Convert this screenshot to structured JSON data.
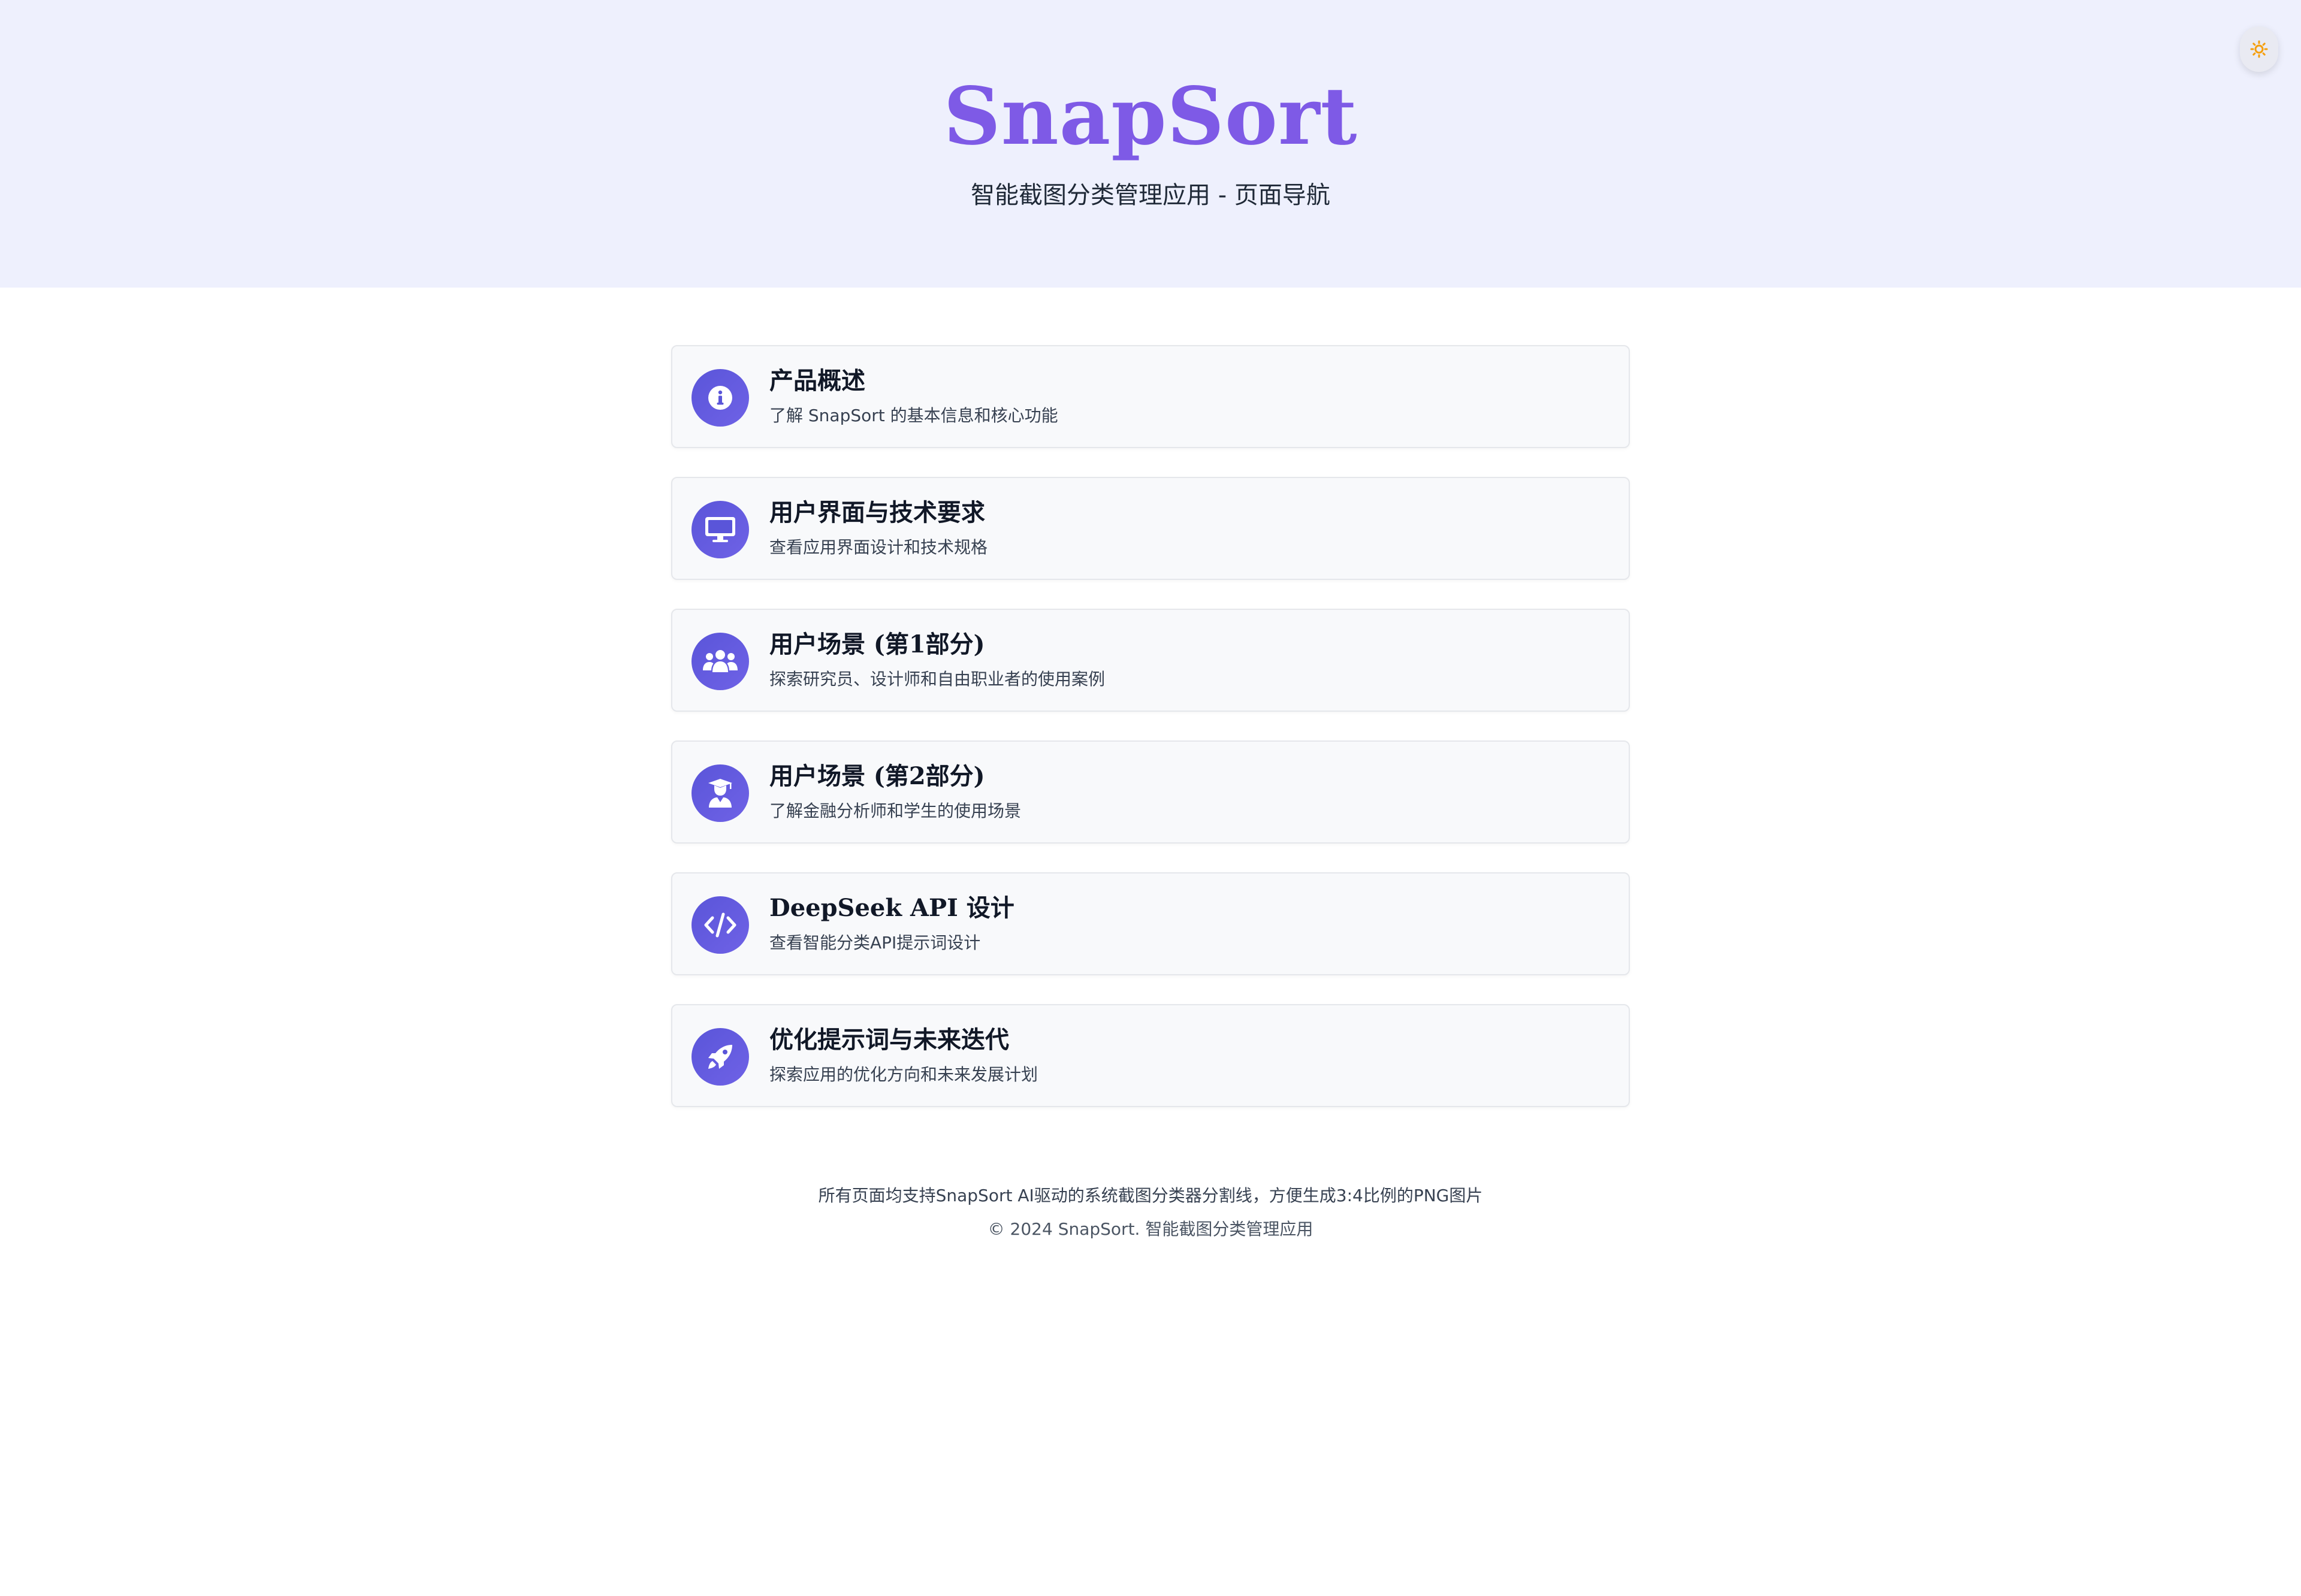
{
  "header": {
    "brand": "SnapSort",
    "tagline": "智能截图分类管理应用 - 页面导航",
    "theme_toggle_icon": "sun-icon",
    "accent_color": "#7e5ae6",
    "toggle_icon_color": "#f59e0b"
  },
  "nav": {
    "items": [
      {
        "title": "产品概述",
        "description": "了解 SnapSort 的基本信息和核心功能",
        "icon": "info-icon"
      },
      {
        "title": "用户界面与技术要求",
        "description": "查看应用界面设计和技术规格",
        "icon": "desktop-icon"
      },
      {
        "title": "用户场景 (第1部分)",
        "description": "探索研究员、设计师和自由职业者的使用案例",
        "icon": "users-icon"
      },
      {
        "title": "用户场景 (第2部分)",
        "description": "了解金融分析师和学生的使用场景",
        "icon": "graduate-icon"
      },
      {
        "title": "DeepSeek API 设计",
        "description": "查看智能分类API提示词设计",
        "icon": "code-icon"
      },
      {
        "title": "优化提示词与未来迭代",
        "description": "探索应用的优化方向和未来发展计划",
        "icon": "rocket-icon"
      }
    ],
    "icon_color": "#5a55d9"
  },
  "footer": {
    "note": "所有页面均支持SnapSort AI驱动的系统截图分类器分割线，方便生成3:4比例的PNG图片",
    "copyright": "© 2024 SnapSort. 智能截图分类管理应用"
  }
}
